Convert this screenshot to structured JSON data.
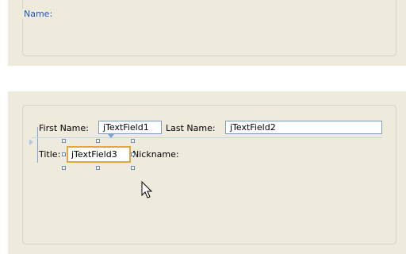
{
  "colors": {
    "panel_bg": "#efebdc",
    "group_title": "#1c59c4",
    "field_border": "#7f9db9",
    "selection_border": "#e0a83c",
    "guide": "#7ea3d6"
  },
  "bottom_group": {
    "title": "Name:",
    "first_name_label": "First Name:",
    "first_name_field": "jTextField1",
    "last_name_label": "Last Name:",
    "last_name_field": "jTextField2",
    "title_label": "Title:",
    "title_field": "jTextField3",
    "nickname_label": "Nickname:"
  },
  "icons": {
    "cursor": "mouse-pointer-icon",
    "anchor": "anchor-arrow-icon"
  }
}
